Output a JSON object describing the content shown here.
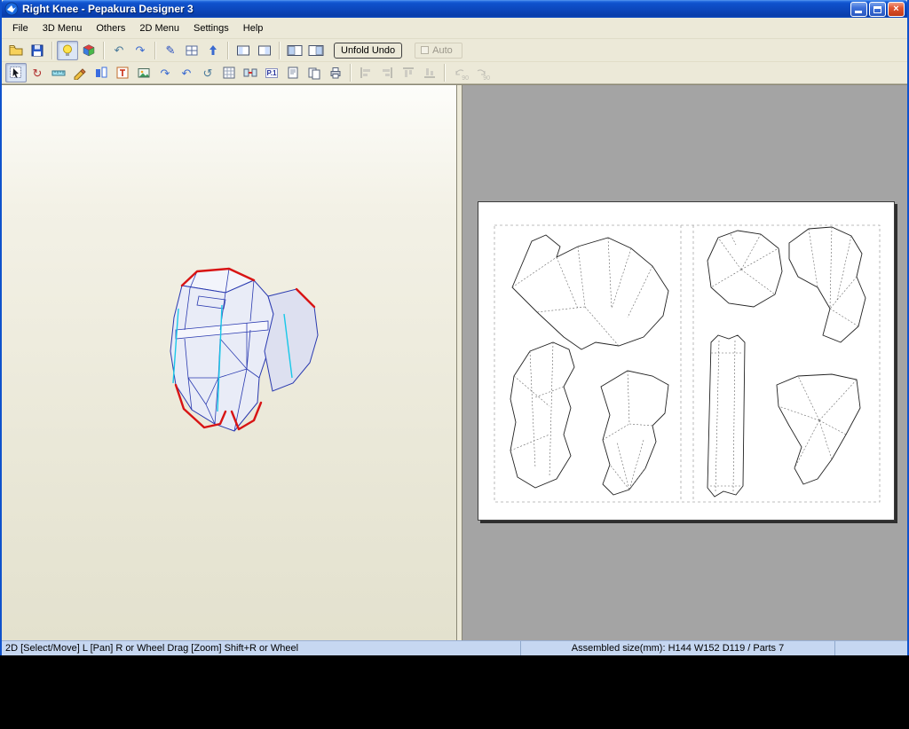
{
  "window": {
    "title": "Right Knee - Pepakura Designer 3"
  },
  "menu": {
    "items": [
      {
        "label": "File"
      },
      {
        "label": "3D Menu"
      },
      {
        "label": "Others"
      },
      {
        "label": "2D Menu"
      },
      {
        "label": "Settings"
      },
      {
        "label": "Help"
      }
    ]
  },
  "toolbar": {
    "unfold_undo": "Unfold Undo",
    "auto": "Auto",
    "page_indicator": "P.1",
    "rotate_ccw_label": "90",
    "rotate_cw_label": "90",
    "row1_icons": [
      "open-folder",
      "save-floppy",
      "light-bulb",
      "texture-cube",
      "undo-arrow",
      "redo-arrow",
      "pen",
      "mesh-window",
      "flip-up",
      "window-3d",
      "window-2d",
      "split-view-left",
      "split-view-right"
    ],
    "row2_icons": [
      "select-move",
      "rotate-tool",
      "ruler",
      "paint-flap",
      "layers",
      "text",
      "image",
      "curve-right",
      "curve-left",
      "rotate-ccw",
      "grid",
      "join-parts",
      "page-number",
      "page-setup",
      "pages",
      "printer",
      "align-left",
      "align-right",
      "align-top",
      "align-bottom",
      "rotate-90-ccw",
      "rotate-90-cw"
    ]
  },
  "statusbar": {
    "left": "2D [Select/Move] L [Pan] R or Wheel Drag [Zoom] Shift+R or Wheel",
    "right": "Assembled size(mm): H144 W152 D119 / Parts 7"
  },
  "panes": {
    "left": {
      "type": "3d-model-view"
    },
    "right": {
      "type": "2d-pattern-view",
      "pages_visible": 2,
      "parts_visible": 7
    }
  },
  "colors": {
    "titlebar_blue": "#0f52cc",
    "toolbar_bg": "#ece9d8",
    "left_pane_bg": "#eeecdd",
    "right_pane_bg": "#a4a4a4",
    "open_edge_red": "#d81414",
    "fold_edge_blue": "#2a3ab0",
    "highlight_cyan": "#1ac8e8",
    "statusbar_bg": "#c6d7f1"
  }
}
